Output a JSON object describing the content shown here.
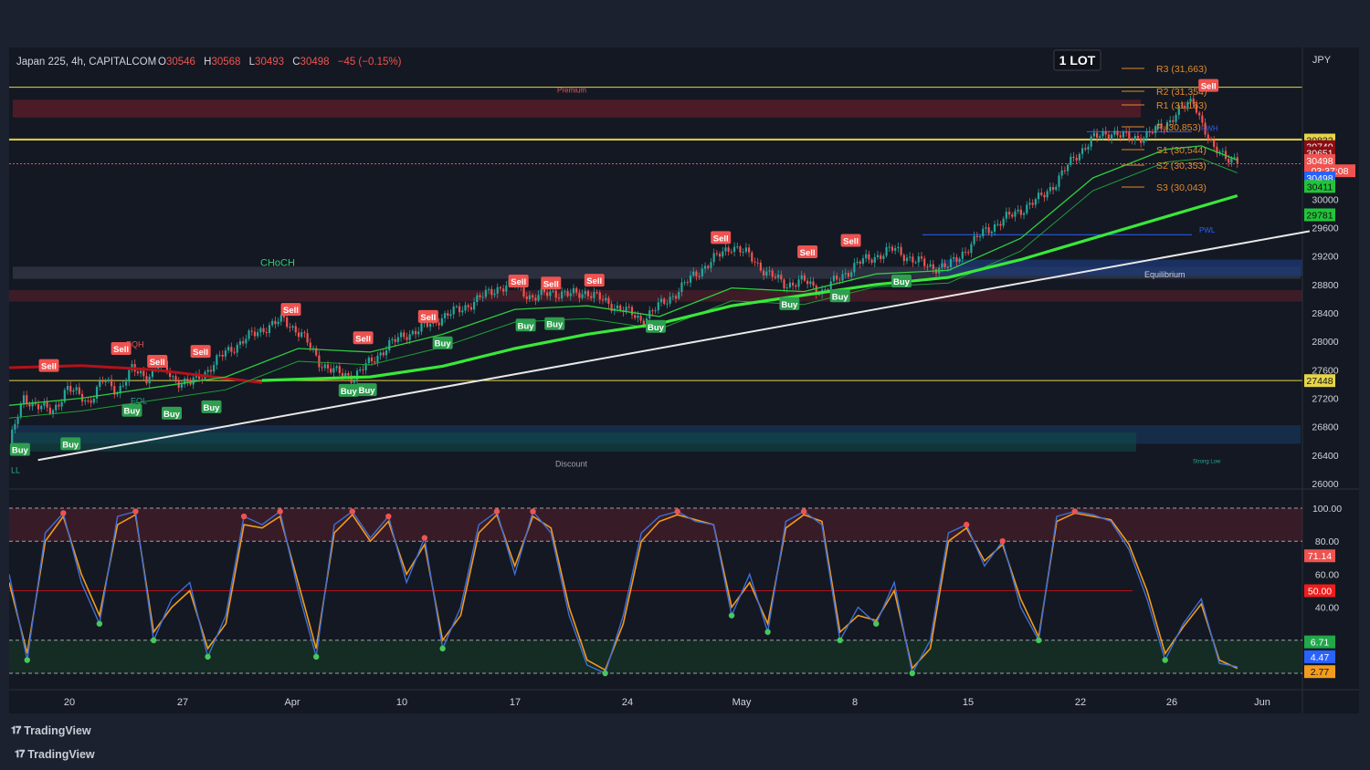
{
  "header": {
    "symbol": "Japan 225, 4h, CAPITALCOM",
    "o_label": "O",
    "o": "30546",
    "h_label": "H",
    "h": "30568",
    "l_label": "L",
    "l": "30493",
    "c_label": "C",
    "c": "30498",
    "change": "−45 (−0.15%)",
    "lot_badge": "1 LOT",
    "currency": "JPY"
  },
  "colors": {
    "background": "#141822",
    "up": "#26a69a",
    "down": "#ef5350",
    "ema_fast": "#2ecc40",
    "ema_slow": "#39e83a",
    "trendline": "#e8e8e8",
    "stoch_k": "#3f6fd8",
    "stoch_d": "#f29b1d",
    "level": "#e5d44a"
  },
  "pivots": [
    {
      "label": "R3 (31,663)",
      "value": 31663
    },
    {
      "label": "R2 (31,354)",
      "value": 31354
    },
    {
      "label": "R1 (31,163)",
      "value": 31163
    },
    {
      "label": "P (30,853)",
      "value": 30853
    },
    {
      "label": "S1 (30,544)",
      "value": 30544
    },
    {
      "label": "S2 (30,353)",
      "value": 30353
    },
    {
      "label": "S3 (30,043)",
      "value": 30043
    }
  ],
  "zone_labels": {
    "premium": "Premium",
    "equilibrium": "Equilibrium",
    "discount": "Discount",
    "choch": "CHoCH",
    "pwh": "PWH",
    "pwl": "PWL",
    "eqh": "EQH",
    "eql": "EQL",
    "strong_low": "Strong Low",
    "ll": "LL"
  },
  "signals": {
    "sell": "Sell",
    "buy": "Buy"
  },
  "price_axis": {
    "ticks": [
      "30000",
      "29600",
      "29200",
      "28800",
      "28400",
      "28000",
      "27600",
      "27200",
      "26800",
      "26400",
      "26000"
    ],
    "tick_values": [
      30000,
      29600,
      29200,
      28800,
      28400,
      28000,
      27600,
      27200,
      26800,
      26400,
      26000
    ],
    "badges": [
      {
        "text": "30832",
        "value": 30832,
        "bg": "#e5d44a",
        "fg": "#111"
      },
      {
        "text": "30740",
        "value": 30740,
        "bg": "#8b0d14",
        "fg": "#fff"
      },
      {
        "text": "30651",
        "value": 30651,
        "bg": "#8b0d14",
        "fg": "#fff"
      },
      {
        "text": "30498",
        "value": 30545,
        "bg": "#ef5350",
        "fg": "#fff"
      },
      {
        "text": "03:37:08",
        "value": 30400,
        "bg": "#ef5350",
        "fg": "#fff"
      },
      {
        "text": "30498",
        "value": 30300,
        "bg": "#2962ff",
        "fg": "#fff"
      },
      {
        "text": "30411",
        "value": 30180,
        "bg": "#21c43a",
        "fg": "#111"
      },
      {
        "text": "29781",
        "value": 29780,
        "bg": "#21c43a",
        "fg": "#111"
      },
      {
        "text": "27448",
        "value": 27448,
        "bg": "#e5d44a",
        "fg": "#111"
      }
    ]
  },
  "oscillator_axis": {
    "ticks": [
      "100.00",
      "80.00",
      "60.00",
      "40.00"
    ],
    "tick_values": [
      100,
      80,
      60,
      40
    ],
    "badges": [
      {
        "text": "71.14",
        "value": 71.14,
        "bg": "#ef5350",
        "fg": "#fff"
      },
      {
        "text": "50.00",
        "value": 50,
        "bg": "#ef1c1c",
        "fg": "#fff"
      },
      {
        "text": "6.71",
        "value": 19,
        "bg": "#21a84a",
        "fg": "#fff"
      },
      {
        "text": "4.47",
        "value": 10,
        "bg": "#2962ff",
        "fg": "#fff"
      },
      {
        "text": "2.77",
        "value": 1,
        "bg": "#f29b1d",
        "fg": "#111"
      }
    ]
  },
  "time_axis": [
    "20",
    "27",
    "Apr",
    "10",
    "17",
    "24",
    "May",
    "8",
    "15",
    "22",
    "26",
    "Jun"
  ],
  "brand": [
    "TradingView",
    "TradingView"
  ],
  "chart_data": {
    "type": "candlestick",
    "title": "Japan 225, 4h, CAPITALCOM",
    "x_labels": [
      "20",
      "27",
      "Apr",
      "10",
      "17",
      "24",
      "May",
      "8",
      "15",
      "22",
      "26",
      "Jun"
    ],
    "ylim": [
      26000,
      31750
    ],
    "close_path": [
      [
        0,
        26550
      ],
      [
        0.4,
        27200
      ],
      [
        1.2,
        27000
      ],
      [
        1.6,
        27350
      ],
      [
        2.2,
        27150
      ],
      [
        2.6,
        27450
      ],
      [
        3.0,
        27300
      ],
      [
        3.4,
        27600
      ],
      [
        3.8,
        27500
      ],
      [
        4.2,
        27700
      ],
      [
        4.6,
        27450
      ],
      [
        5.0,
        27400
      ],
      [
        5.5,
        27600
      ],
      [
        6.0,
        27850
      ],
      [
        6.6,
        28050
      ],
      [
        7.1,
        28200
      ],
      [
        7.6,
        28300
      ],
      [
        8.1,
        28100
      ],
      [
        8.6,
        27700
      ],
      [
        9.1,
        27550
      ],
      [
        9.5,
        27500
      ],
      [
        10.0,
        27700
      ],
      [
        10.5,
        27950
      ],
      [
        11.0,
        28100
      ],
      [
        11.5,
        28200
      ],
      [
        12.0,
        28350
      ],
      [
        12.5,
        28450
      ],
      [
        13.0,
        28600
      ],
      [
        13.5,
        28750
      ],
      [
        14.0,
        28800
      ],
      [
        14.5,
        28600
      ],
      [
        15.0,
        28700
      ],
      [
        15.5,
        28650
      ],
      [
        16.0,
        28700
      ],
      [
        16.5,
        28550
      ],
      [
        17.0,
        28450
      ],
      [
        17.5,
        28300
      ],
      [
        18.0,
        28500
      ],
      [
        18.5,
        28700
      ],
      [
        19.0,
        28950
      ],
      [
        19.5,
        29150
      ],
      [
        20.0,
        29350
      ],
      [
        20.5,
        29200
      ],
      [
        21.0,
        28950
      ],
      [
        21.5,
        28800
      ],
      [
        22.0,
        28850
      ],
      [
        22.5,
        28700
      ],
      [
        23.0,
        28900
      ],
      [
        23.5,
        29100
      ],
      [
        24.0,
        29200
      ],
      [
        24.5,
        29300
      ],
      [
        25.0,
        29150
      ],
      [
        25.5,
        29050
      ],
      [
        26.0,
        29050
      ],
      [
        26.5,
        29300
      ],
      [
        27.0,
        29550
      ],
      [
        27.5,
        29700
      ],
      [
        28.0,
        29850
      ],
      [
        28.5,
        30000
      ],
      [
        29.0,
        30250
      ],
      [
        29.5,
        30600
      ],
      [
        30.0,
        30850
      ],
      [
        30.5,
        30950
      ],
      [
        31.0,
        30850
      ],
      [
        31.5,
        30900
      ],
      [
        32.0,
        31050
      ],
      [
        32.4,
        31250
      ],
      [
        32.8,
        31400
      ],
      [
        33.0,
        31100
      ],
      [
        33.3,
        30700
      ],
      [
        33.6,
        30650
      ],
      [
        34.0,
        30520
      ]
    ],
    "ema_fast": [
      [
        0,
        27100
      ],
      [
        2,
        27200
      ],
      [
        4,
        27350
      ],
      [
        6,
        27500
      ],
      [
        8,
        27900
      ],
      [
        10,
        27850
      ],
      [
        12,
        28100
      ],
      [
        14,
        28450
      ],
      [
        16,
        28500
      ],
      [
        18,
        28350
      ],
      [
        20,
        28750
      ],
      [
        22,
        28700
      ],
      [
        24,
        28950
      ],
      [
        26,
        29000
      ],
      [
        28,
        29450
      ],
      [
        30,
        30300
      ],
      [
        32,
        30700
      ],
      [
        33,
        30750
      ],
      [
        34,
        30550
      ]
    ],
    "ema_slow": [
      [
        7,
        27450
      ],
      [
        10,
        27500
      ],
      [
        12,
        27650
      ],
      [
        14,
        27900
      ],
      [
        16,
        28100
      ],
      [
        18,
        28250
      ],
      [
        20,
        28500
      ],
      [
        22,
        28650
      ],
      [
        24,
        28800
      ],
      [
        26,
        28900
      ],
      [
        28,
        29150
      ],
      [
        30,
        29450
      ],
      [
        32,
        29750
      ],
      [
        34,
        30050
      ]
    ],
    "trendline": [
      [
        0.8,
        26330
      ],
      [
        36,
        29550
      ]
    ],
    "stoch_k": [
      [
        0,
        60
      ],
      [
        0.5,
        8
      ],
      [
        1,
        85
      ],
      [
        1.5,
        97
      ],
      [
        2,
        55
      ],
      [
        2.5,
        30
      ],
      [
        3,
        95
      ],
      [
        3.5,
        98
      ],
      [
        4,
        20
      ],
      [
        4.5,
        45
      ],
      [
        5,
        55
      ],
      [
        5.5,
        10
      ],
      [
        6,
        35
      ],
      [
        6.5,
        95
      ],
      [
        7,
        90
      ],
      [
        7.5,
        98
      ],
      [
        8,
        50
      ],
      [
        8.5,
        10
      ],
      [
        9,
        90
      ],
      [
        9.5,
        98
      ],
      [
        10,
        82
      ],
      [
        10.5,
        95
      ],
      [
        11,
        55
      ],
      [
        11.5,
        82
      ],
      [
        12,
        15
      ],
      [
        12.5,
        40
      ],
      [
        13,
        90
      ],
      [
        13.5,
        98
      ],
      [
        14,
        60
      ],
      [
        14.5,
        98
      ],
      [
        15,
        85
      ],
      [
        15.5,
        35
      ],
      [
        16,
        5
      ],
      [
        16.5,
        0
      ],
      [
        17,
        35
      ],
      [
        17.5,
        85
      ],
      [
        18,
        95
      ],
      [
        18.5,
        98
      ],
      [
        19,
        92
      ],
      [
        19.5,
        90
      ],
      [
        20,
        35
      ],
      [
        20.5,
        60
      ],
      [
        21,
        25
      ],
      [
        21.5,
        92
      ],
      [
        22,
        98
      ],
      [
        22.5,
        90
      ],
      [
        23,
        20
      ],
      [
        23.5,
        40
      ],
      [
        24,
        30
      ],
      [
        24.5,
        55
      ],
      [
        25,
        0
      ],
      [
        25.5,
        20
      ],
      [
        26,
        85
      ],
      [
        26.5,
        90
      ],
      [
        27,
        65
      ],
      [
        27.5,
        80
      ],
      [
        28,
        40
      ],
      [
        28.5,
        20
      ],
      [
        29,
        95
      ],
      [
        29.5,
        98
      ],
      [
        30,
        96
      ],
      [
        30.5,
        92
      ],
      [
        31,
        75
      ],
      [
        31.5,
        45
      ],
      [
        32,
        8
      ],
      [
        32.5,
        30
      ],
      [
        33,
        45
      ],
      [
        33.5,
        6
      ],
      [
        34,
        4
      ]
    ],
    "stoch_d": [
      [
        0,
        55
      ],
      [
        0.5,
        12
      ],
      [
        1,
        80
      ],
      [
        1.5,
        95
      ],
      [
        2,
        60
      ],
      [
        2.5,
        35
      ],
      [
        3,
        90
      ],
      [
        3.5,
        96
      ],
      [
        4,
        25
      ],
      [
        4.5,
        40
      ],
      [
        5,
        50
      ],
      [
        5.5,
        15
      ],
      [
        6,
        30
      ],
      [
        6.5,
        90
      ],
      [
        7,
        88
      ],
      [
        7.5,
        95
      ],
      [
        8,
        55
      ],
      [
        8.5,
        15
      ],
      [
        9,
        85
      ],
      [
        9.5,
        96
      ],
      [
        10,
        80
      ],
      [
        10.5,
        92
      ],
      [
        11,
        60
      ],
      [
        11.5,
        78
      ],
      [
        12,
        20
      ],
      [
        12.5,
        35
      ],
      [
        13,
        85
      ],
      [
        13.5,
        96
      ],
      [
        14,
        65
      ],
      [
        14.5,
        95
      ],
      [
        15,
        88
      ],
      [
        15.5,
        40
      ],
      [
        16,
        8
      ],
      [
        16.5,
        2
      ],
      [
        17,
        30
      ],
      [
        17.5,
        80
      ],
      [
        18,
        92
      ],
      [
        18.5,
        96
      ],
      [
        19,
        93
      ],
      [
        19.5,
        90
      ],
      [
        20,
        40
      ],
      [
        20.5,
        55
      ],
      [
        21,
        30
      ],
      [
        21.5,
        88
      ],
      [
        22,
        96
      ],
      [
        22.5,
        92
      ],
      [
        23,
        25
      ],
      [
        23.5,
        35
      ],
      [
        24,
        32
      ],
      [
        24.5,
        50
      ],
      [
        25,
        3
      ],
      [
        25.5,
        15
      ],
      [
        26,
        80
      ],
      [
        26.5,
        88
      ],
      [
        27,
        68
      ],
      [
        27.5,
        78
      ],
      [
        28,
        45
      ],
      [
        28.5,
        22
      ],
      [
        29,
        92
      ],
      [
        29.5,
        97
      ],
      [
        30,
        95
      ],
      [
        30.5,
        93
      ],
      [
        31,
        78
      ],
      [
        31.5,
        50
      ],
      [
        32,
        12
      ],
      [
        32.5,
        28
      ],
      [
        33,
        42
      ],
      [
        33.5,
        8
      ],
      [
        34,
        3
      ]
    ],
    "stoch_levels": [
      100,
      80,
      50,
      20,
      0
    ],
    "sell_signals": [
      [
        1.1,
        27660
      ],
      [
        3.1,
        27900
      ],
      [
        4.1,
        27720
      ],
      [
        5.3,
        27860
      ],
      [
        7.8,
        28450
      ],
      [
        9.8,
        28050
      ],
      [
        11.6,
        28350
      ],
      [
        14.1,
        28850
      ],
      [
        15.0,
        28820
      ],
      [
        16.2,
        28860
      ],
      [
        19.7,
        29460
      ],
      [
        22.1,
        29260
      ],
      [
        23.3,
        29420
      ],
      [
        33.2,
        31600
      ]
    ],
    "buy_signals": [
      [
        0.3,
        26480
      ],
      [
        1.7,
        26560
      ],
      [
        3.4,
        27030
      ],
      [
        4.5,
        26990
      ],
      [
        5.6,
        27080
      ],
      [
        9.4,
        27310
      ],
      [
        9.9,
        27320
      ],
      [
        12.0,
        27980
      ],
      [
        14.3,
        28230
      ],
      [
        15.1,
        28250
      ],
      [
        17.9,
        28210
      ],
      [
        21.6,
        28530
      ],
      [
        23.0,
        28640
      ],
      [
        24.7,
        28850
      ]
    ]
  }
}
